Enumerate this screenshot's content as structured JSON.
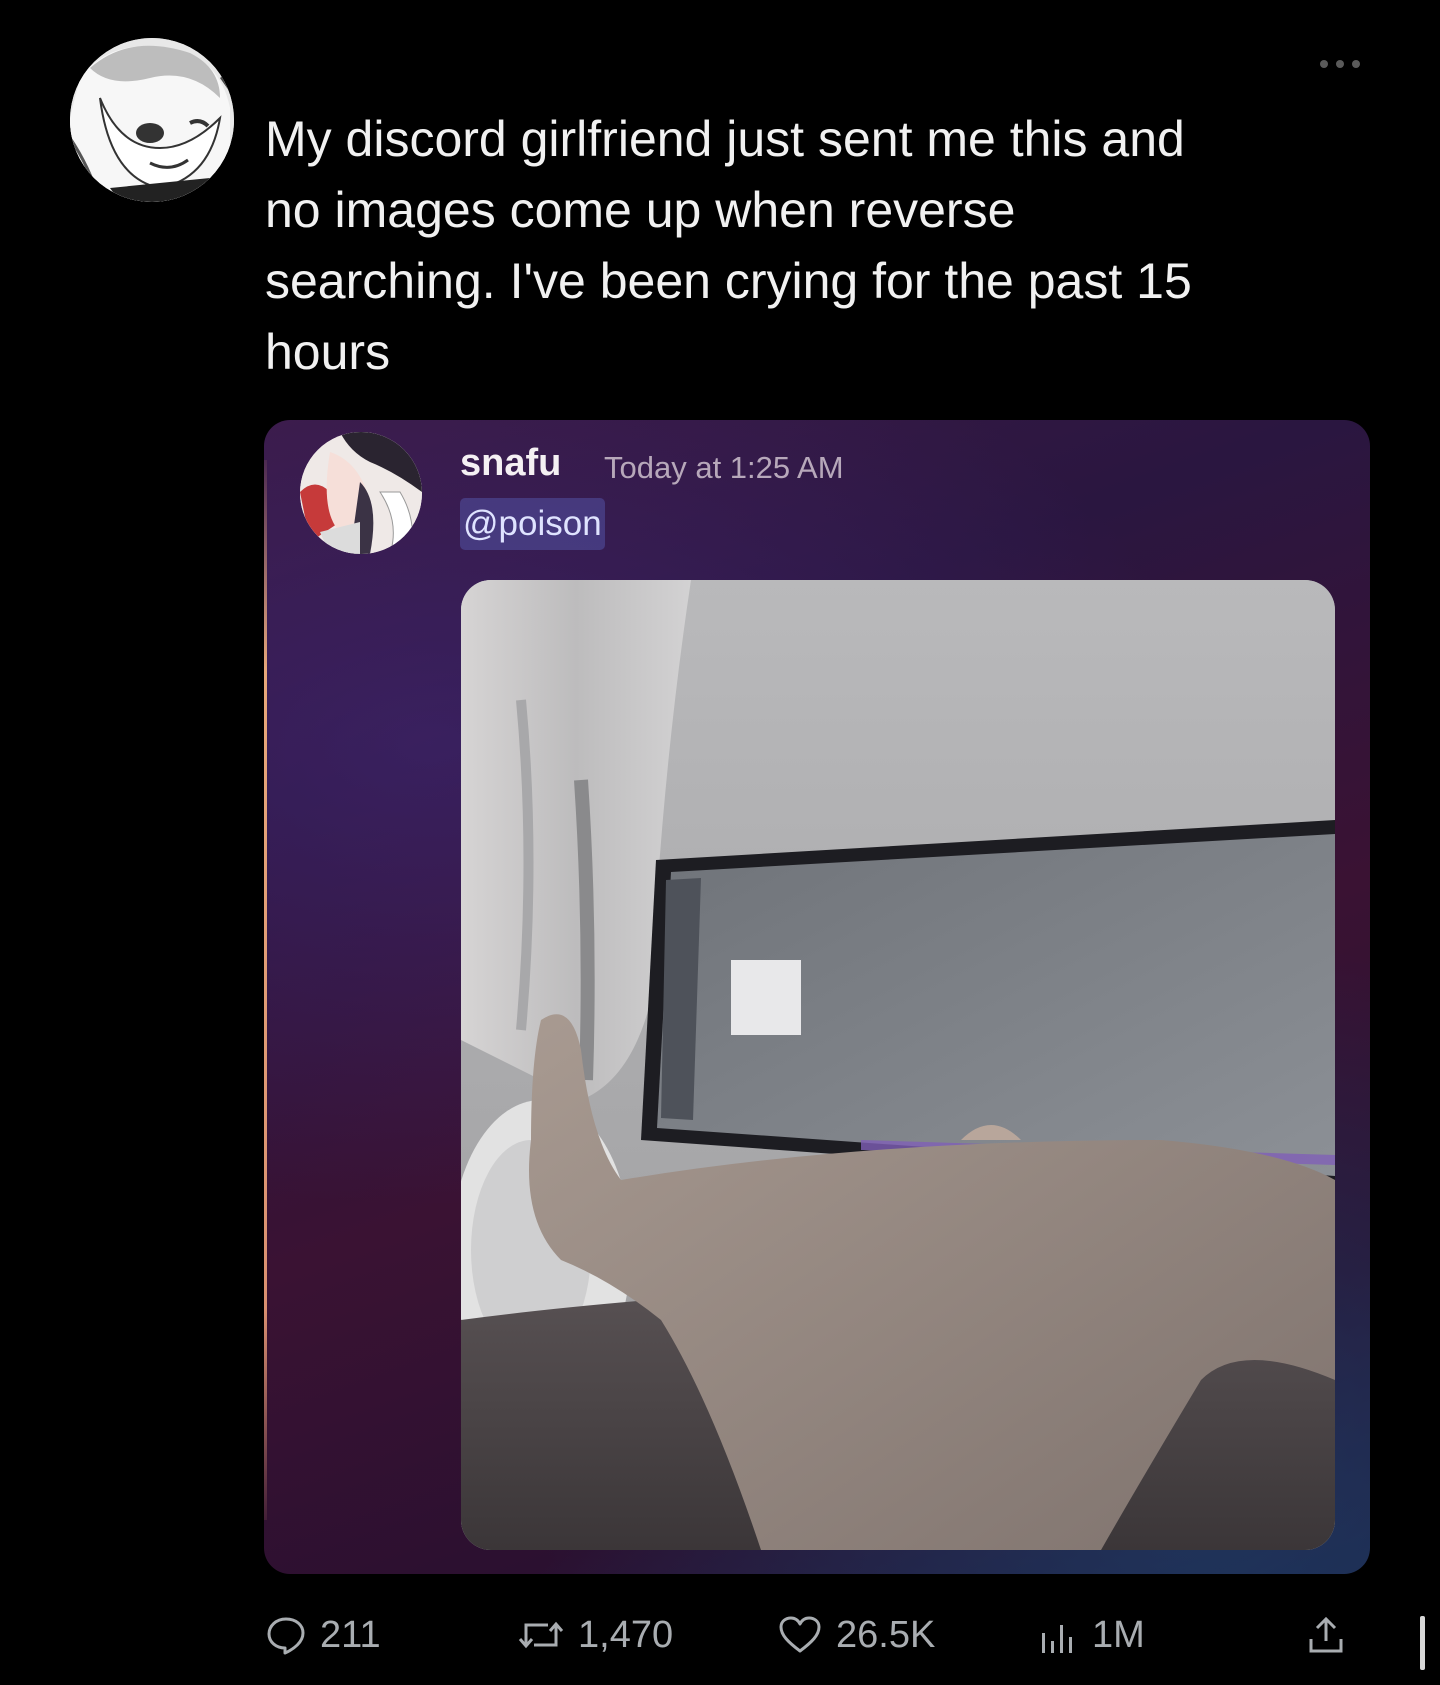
{
  "post": {
    "text": "My discord girlfriend just sent me this and\nno images come up when reverse\nsearching. I've been crying for the past 15\nhours",
    "avatar_icon": "anime-avatar-icon",
    "more_icon": "more-options-icon"
  },
  "embed": {
    "username": "snafu",
    "timestamp": "Today at 1:25 AM",
    "mention": "@poison",
    "accent_color": "#e7a87a",
    "mention_color": "#5f69c8"
  },
  "actions": {
    "replies": "211",
    "reposts": "1,470",
    "likes": "26.5K",
    "views": "1M"
  }
}
